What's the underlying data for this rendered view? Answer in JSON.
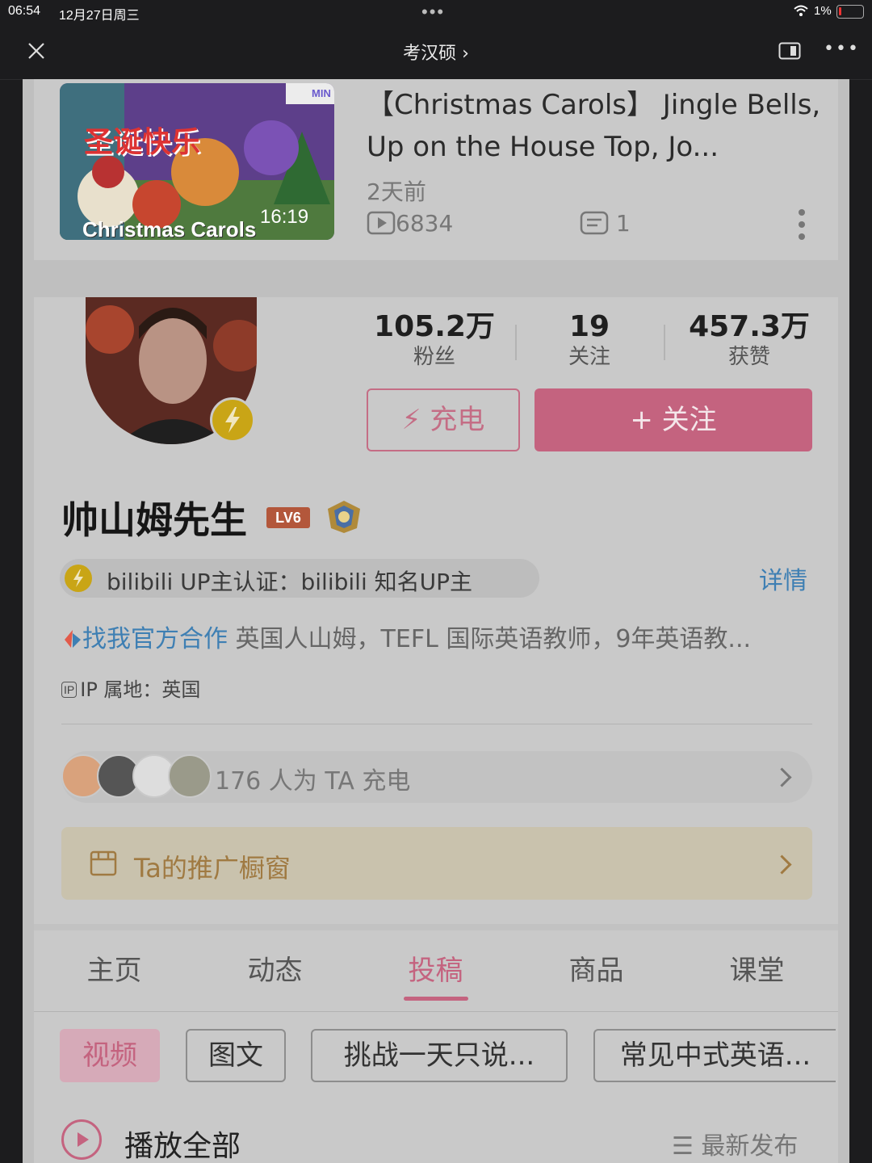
{
  "status_bar": {
    "time": "06:54",
    "date": "12月27日周三",
    "center": "•••",
    "battery_pct": "1%"
  },
  "header": {
    "title": "考汉硕 ›",
    "more": "•••"
  },
  "video": {
    "title": "【Christmas Carols】 Jingle Bells, Up on the House Top, Jo...",
    "thumb_title": "圣诞快乐",
    "thumb_caption": "Christmas Carols",
    "thumb_tag": "MIN",
    "duration": "16:19",
    "posted": "2天前",
    "plays": "6834",
    "comments": "1"
  },
  "profile": {
    "stats": [
      {
        "value": "105.2万",
        "label": "粉丝"
      },
      {
        "value": "19",
        "label": "关注"
      },
      {
        "value": "457.3万",
        "label": "获赞"
      }
    ],
    "charge_button": "⚡ 充电",
    "follow_button": "+ 关注",
    "name": "帅山姆先生",
    "level": "LV6",
    "certification": "bilibili UP主认证：bilibili 知名UP主",
    "details_link": "详情",
    "bio_link": "找我官方合作",
    "bio": " 英国人山姆，TEFL 国际英语教师，9年英语教...",
    "ip_tag": "IP",
    "ip": "IP 属地：英国",
    "chargers_text": "176 人为 TA 充电",
    "showcase": "Ta的推广橱窗"
  },
  "tabs": [
    "主页",
    "动态",
    "投稿",
    "商品",
    "课堂"
  ],
  "active_tab": "投稿",
  "chips": [
    "视频",
    "图文",
    "挑战一天只说...",
    "常见中式英语..."
  ],
  "play_all": "播放全部",
  "sort": "☰ 最新发布",
  "colors": {
    "accent": "#c4637f",
    "link": "#3e7fb3",
    "gold": "#c9a516"
  }
}
